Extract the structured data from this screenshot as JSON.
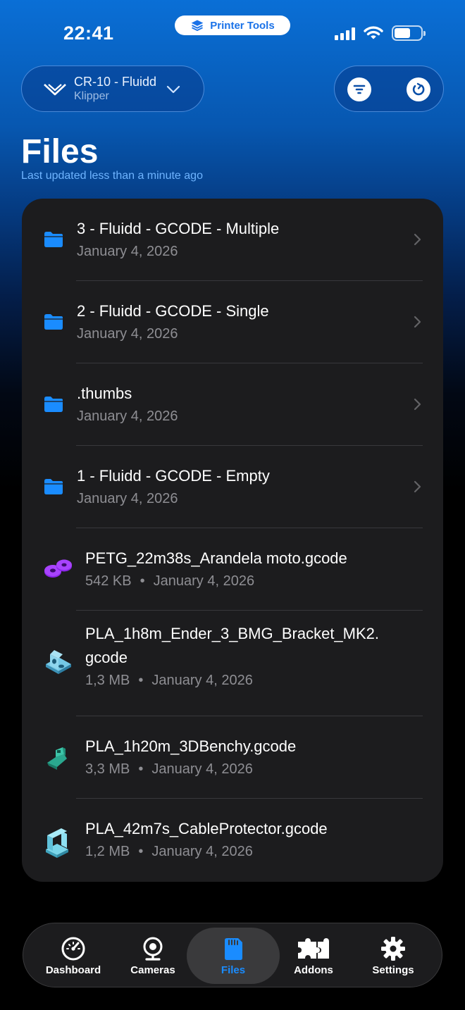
{
  "status_bar": {
    "time": "22:41",
    "app_pill": "Printer Tools"
  },
  "header": {
    "printer_name": "CR-10 - Fluidd",
    "printer_sub": "Klipper"
  },
  "page": {
    "title": "Files",
    "updated": "Last updated less than a minute ago"
  },
  "files": [
    {
      "type": "folder",
      "name": "3 - Fluidd - GCODE - Multiple",
      "date": "January 4, 2026"
    },
    {
      "type": "folder",
      "name": "2 - Fluidd - GCODE - Single",
      "date": "January 4, 2026"
    },
    {
      "type": "folder",
      "name": ".thumbs",
      "date": "January 4, 2026"
    },
    {
      "type": "folder",
      "name": "1 - Fluidd - GCODE - Empty",
      "date": "January 4, 2026"
    },
    {
      "type": "gcode",
      "name": "PETG_22m38s_Arandela moto.gcode",
      "size": "542 KB",
      "sep": "•",
      "date": "January 4, 2026",
      "thumb_color": "#9b30ff"
    },
    {
      "type": "gcode",
      "name_line1": "PLA_1h8m_Ender_3_BMG_Bracket_MK2.",
      "name_line2": "gcode",
      "size": "1,3 MB",
      "sep": "•",
      "date": "January 4, 2026",
      "thumb_color": "#6fc3e0"
    },
    {
      "type": "gcode",
      "name": "PLA_1h20m_3DBenchy.gcode",
      "size": "3,3 MB",
      "sep": "•",
      "date": "January 4, 2026",
      "thumb_color": "#2fb39a"
    },
    {
      "type": "gcode",
      "name": "PLA_42m7s_CableProtector.gcode",
      "size": "1,2 MB",
      "sep": "•",
      "date": "January 4, 2026",
      "thumb_color": "#6fd1e6"
    }
  ],
  "tabs": [
    {
      "label": "Dashboard",
      "icon": "gauge-icon"
    },
    {
      "label": "Cameras",
      "icon": "webcam-icon"
    },
    {
      "label": "Files",
      "icon": "sd-card-icon",
      "active": true
    },
    {
      "label": "Addons",
      "icon": "puzzle-icon"
    },
    {
      "label": "Settings",
      "icon": "gear-icon"
    }
  ],
  "colors": {
    "accent": "#1a8cff",
    "folder": "#1a8cff",
    "card": "#1c1c1e"
  }
}
